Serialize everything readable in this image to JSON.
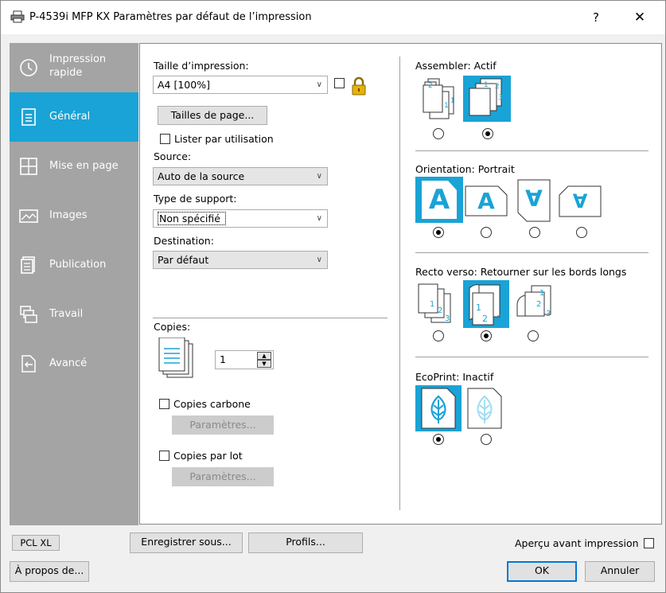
{
  "window": {
    "title": "P-4539i MFP KX Paramètres par défaut de l’impression",
    "help": "?",
    "close": "✕"
  },
  "sidebar": {
    "items": [
      {
        "label": "Impression rapide",
        "icon": "clock-icon",
        "active": false
      },
      {
        "label": "Général",
        "icon": "document-icon",
        "active": true
      },
      {
        "label": "Mise en page",
        "icon": "layout-grid-icon",
        "active": false
      },
      {
        "label": "Images",
        "icon": "image-icon",
        "active": false
      },
      {
        "label": "Publication",
        "icon": "publication-icon",
        "active": false
      },
      {
        "label": "Travail",
        "icon": "job-icon",
        "active": false
      },
      {
        "label": "Avancé",
        "icon": "advanced-icon",
        "active": false
      }
    ]
  },
  "general": {
    "print_size_label": "Taille d’impression:",
    "print_size_value": "A4  [100%]",
    "page_sizes_button": "Tailles de page...",
    "list_by_usage_label": "Lister par utilisation",
    "source_label": "Source:",
    "source_value": "Auto de la source",
    "media_type_label": "Type de support:",
    "media_type_value": "Non spécifié",
    "destination_label": "Destination:",
    "destination_value": "Par défaut",
    "copies_label": "Copies:",
    "copies_value": "1",
    "carbon_copies_label": "Copies carbone",
    "carbon_settings_button": "Paramètres...",
    "batch_copies_label": "Copies par lot",
    "batch_settings_button": "Paramètres..."
  },
  "right": {
    "collate_label": "Assembler:",
    "collate_value": "Actif",
    "orientation_label": "Orientation:",
    "orientation_value": "Portrait",
    "duplex_label": "Recto verso:",
    "duplex_value": "Retourner sur les bords longs",
    "ecoprint_label": "EcoPrint:",
    "ecoprint_value": "Inactif",
    "orientation_glyph": "A",
    "orientation_glyph_flipped": "∀"
  },
  "footer": {
    "pdl_button": "PCL XL",
    "save_as_button": "Enregistrer sous...",
    "profiles_button": "Profils...",
    "preview_label": "Aperçu avant impression",
    "about_button": "À propos de...",
    "ok_button": "OK",
    "cancel_button": "Annuler"
  },
  "colors": {
    "accent": "#1aa3d6",
    "sidebar": "#a4a4a4"
  }
}
